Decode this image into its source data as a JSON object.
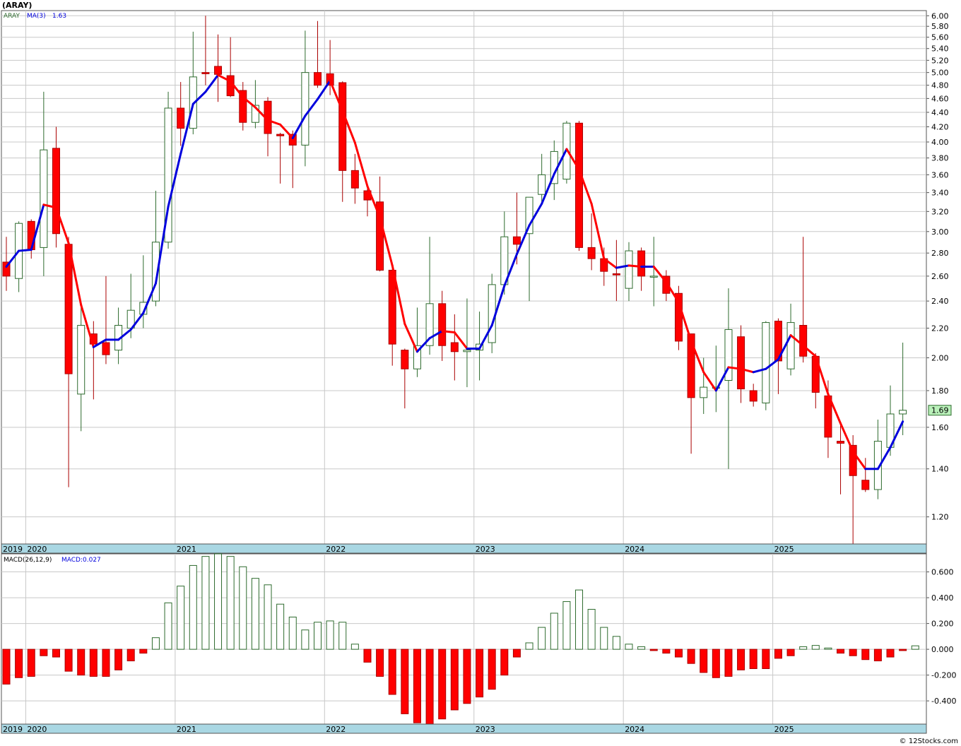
{
  "title": "(ARAY)",
  "watermark": "© 12Stocks.com",
  "colors": {
    "up_body": "#ffffff",
    "up_outline": "#2e6b2e",
    "down_body": "#ff0000",
    "down_outline": "#aa0000",
    "ma_up": "#0000dd",
    "ma_down": "#ff0000",
    "grid": "#c8c8c8",
    "axis_band": "#a9d7e3",
    "last_price_bg": "#b9f0b9"
  },
  "chart_data": [
    {
      "type": "candlestick",
      "legend": {
        "symbol": "ARAY",
        "ma_label": "MA(3)",
        "ma_value": "1.63"
      },
      "last_price_label": "1.69",
      "yscale": "log",
      "ylim": [
        1.1,
        6.1
      ],
      "y_ticks": [
        "6.00",
        "5.80",
        "5.60",
        "5.40",
        "5.20",
        "5.00",
        "4.80",
        "4.60",
        "4.40",
        "4.20",
        "4.00",
        "3.80",
        "3.60",
        "3.40",
        "3.20",
        "3.00",
        "2.80",
        "2.60",
        "2.40",
        "2.20",
        "2.00",
        "1.80",
        "1.60",
        "1.40",
        "1.20"
      ],
      "x_labels": [
        "2019",
        "2020",
        "2021",
        "2022",
        "2023",
        "2024",
        "2025"
      ],
      "candles": [
        [
          "2019-11",
          2.72,
          2.95,
          2.48,
          2.6
        ],
        [
          "2019-12",
          2.58,
          3.1,
          2.47,
          3.08
        ],
        [
          "2020-01",
          3.1,
          3.12,
          2.75,
          2.83
        ],
        [
          "2020-02",
          2.85,
          4.7,
          2.6,
          3.9
        ],
        [
          "2020-03",
          3.92,
          4.2,
          2.85,
          2.98
        ],
        [
          "2020-04",
          2.88,
          2.95,
          1.32,
          1.9
        ],
        [
          "2020-05",
          1.78,
          2.35,
          1.58,
          2.22
        ],
        [
          "2020-06",
          2.16,
          2.25,
          1.75,
          2.09
        ],
        [
          "2020-07",
          2.1,
          2.6,
          1.96,
          2.02
        ],
        [
          "2020-08",
          2.05,
          2.35,
          1.96,
          2.22
        ],
        [
          "2020-09",
          2.2,
          2.62,
          2.13,
          2.33
        ],
        [
          "2020-10",
          2.3,
          2.78,
          2.2,
          2.39
        ],
        [
          "2020-11",
          2.4,
          3.42,
          2.36,
          2.9
        ],
        [
          "2020-12",
          2.9,
          4.7,
          2.84,
          4.46
        ],
        [
          "2021-01",
          4.46,
          4.85,
          3.95,
          4.18
        ],
        [
          "2021-02",
          4.18,
          5.7,
          4.1,
          4.93
        ],
        [
          "2021-03",
          5.0,
          6.0,
          4.8,
          4.98
        ],
        [
          "2021-04",
          5.1,
          5.65,
          4.55,
          4.97
        ],
        [
          "2021-05",
          4.95,
          5.6,
          4.62,
          4.64
        ],
        [
          "2021-06",
          4.72,
          4.85,
          4.15,
          4.26
        ],
        [
          "2021-07",
          4.26,
          4.88,
          4.18,
          4.5
        ],
        [
          "2021-08",
          4.56,
          4.62,
          3.82,
          4.11
        ],
        [
          "2021-09",
          4.1,
          4.12,
          3.5,
          4.08
        ],
        [
          "2021-10",
          4.1,
          4.15,
          3.45,
          3.96
        ],
        [
          "2021-11",
          3.96,
          5.72,
          3.7,
          5.0
        ],
        [
          "2021-12",
          5.0,
          5.9,
          4.76,
          4.8
        ],
        [
          "2022-01",
          4.98,
          5.55,
          4.65,
          4.8
        ],
        [
          "2022-02",
          4.84,
          4.86,
          3.3,
          3.65
        ],
        [
          "2022-03",
          3.65,
          3.85,
          3.28,
          3.45
        ],
        [
          "2022-04",
          3.42,
          3.48,
          3.15,
          3.32
        ],
        [
          "2022-05",
          3.3,
          3.58,
          2.64,
          2.65
        ],
        [
          "2022-06",
          2.65,
          2.66,
          1.95,
          2.09
        ],
        [
          "2022-07",
          2.05,
          2.06,
          1.7,
          1.93
        ],
        [
          "2022-08",
          1.93,
          2.35,
          1.88,
          2.08
        ],
        [
          "2022-09",
          2.08,
          2.95,
          2.02,
          2.38
        ],
        [
          "2022-10",
          2.38,
          2.48,
          1.98,
          2.08
        ],
        [
          "2022-11",
          2.1,
          2.3,
          1.86,
          2.04
        ],
        [
          "2022-12",
          2.04,
          2.42,
          1.82,
          2.05
        ],
        [
          "2023-01",
          2.05,
          2.32,
          1.86,
          2.09
        ],
        [
          "2023-02",
          2.1,
          2.62,
          2.03,
          2.53
        ],
        [
          "2023-03",
          2.53,
          3.2,
          2.45,
          2.95
        ],
        [
          "2023-04",
          2.95,
          3.4,
          2.7,
          2.88
        ],
        [
          "2023-05",
          2.98,
          3.35,
          2.4,
          3.35
        ],
        [
          "2023-06",
          3.38,
          3.85,
          3.3,
          3.6
        ],
        [
          "2023-07",
          3.5,
          4.02,
          3.32,
          3.88
        ],
        [
          "2023-08",
          3.55,
          4.28,
          3.5,
          4.25
        ],
        [
          "2023-09",
          4.25,
          4.28,
          2.82,
          2.85
        ],
        [
          "2023-10",
          2.85,
          3.18,
          2.65,
          2.75
        ],
        [
          "2023-11",
          2.75,
          2.85,
          2.52,
          2.64
        ],
        [
          "2023-12",
          2.62,
          2.92,
          2.4,
          2.61
        ],
        [
          "2024-01",
          2.5,
          2.9,
          2.4,
          2.82
        ],
        [
          "2024-02",
          2.82,
          2.85,
          2.48,
          2.6
        ],
        [
          "2024-03",
          2.6,
          2.95,
          2.36,
          2.6
        ],
        [
          "2024-04",
          2.6,
          2.65,
          2.4,
          2.46
        ],
        [
          "2024-05",
          2.46,
          2.52,
          2.05,
          2.11
        ],
        [
          "2024-06",
          2.16,
          2.16,
          1.47,
          1.76
        ],
        [
          "2024-07",
          1.76,
          2.0,
          1.67,
          1.82
        ],
        [
          "2024-08",
          1.82,
          2.08,
          1.68,
          1.82
        ],
        [
          "2024-09",
          1.86,
          2.5,
          1.4,
          2.19
        ],
        [
          "2024-10",
          2.14,
          2.22,
          1.73,
          1.81
        ],
        [
          "2024-11",
          1.8,
          1.84,
          1.71,
          1.74
        ],
        [
          "2024-12",
          1.73,
          2.25,
          1.69,
          2.24
        ],
        [
          "2025-01",
          2.25,
          2.27,
          1.78,
          1.98
        ],
        [
          "2025-02",
          1.93,
          2.38,
          1.89,
          2.24
        ],
        [
          "2025-03",
          2.22,
          2.95,
          1.97,
          2.01
        ],
        [
          "2025-04",
          2.01,
          2.03,
          1.7,
          1.79
        ],
        [
          "2025-05",
          1.77,
          1.86,
          1.45,
          1.55
        ],
        [
          "2025-06",
          1.53,
          1.61,
          1.29,
          1.52
        ],
        [
          "2025-07",
          1.51,
          1.56,
          1.1,
          1.37
        ],
        [
          "2025-08",
          1.35,
          1.45,
          1.3,
          1.31
        ],
        [
          "2025-09",
          1.31,
          1.64,
          1.27,
          1.53
        ],
        [
          "2025-10",
          1.5,
          1.83,
          1.46,
          1.67
        ],
        [
          "2025-11",
          1.67,
          2.1,
          1.56,
          1.69
        ]
      ],
      "ma": [
        2.68,
        2.82,
        2.83,
        3.27,
        3.24,
        2.89,
        2.37,
        2.07,
        2.12,
        2.12,
        2.19,
        2.31,
        2.54,
        3.25,
        3.85,
        4.52,
        4.7,
        4.96,
        4.86,
        4.62,
        4.47,
        4.29,
        4.23,
        4.05,
        4.35,
        4.59,
        4.87,
        4.42,
        3.99,
        3.47,
        3.14,
        2.69,
        2.23,
        2.04,
        2.13,
        2.18,
        2.17,
        2.06,
        2.06,
        2.22,
        2.52,
        2.79,
        3.06,
        3.28,
        3.61,
        3.91,
        3.66,
        3.28,
        2.75,
        2.67,
        2.69,
        2.68,
        2.68,
        2.55,
        2.39,
        2.11,
        1.91,
        1.8,
        1.94,
        1.93,
        1.91,
        1.93,
        1.99,
        2.15,
        2.08,
        2.01,
        1.78,
        1.62,
        1.48,
        1.4,
        1.4,
        1.5,
        1.63
      ]
    },
    {
      "type": "bar",
      "legend": {
        "label": "MACD(26,12,9)",
        "value_label": "MACD:0.027"
      },
      "ylim": [
        -0.58,
        0.74
      ],
      "y_ticks": [
        "0.600",
        "0.400",
        "0.200",
        "0.000",
        "-0.200",
        "-0.400"
      ],
      "x_labels": [
        "2019",
        "2020",
        "2021",
        "2022",
        "2023",
        "2024",
        "2025"
      ],
      "values": [
        -0.27,
        -0.22,
        -0.21,
        -0.05,
        -0.06,
        -0.17,
        -0.2,
        -0.21,
        -0.21,
        -0.16,
        -0.09,
        -0.03,
        0.09,
        0.36,
        0.49,
        0.65,
        0.72,
        0.74,
        0.72,
        0.64,
        0.55,
        0.5,
        0.35,
        0.25,
        0.15,
        0.21,
        0.22,
        0.21,
        0.04,
        -0.1,
        -0.21,
        -0.35,
        -0.5,
        -0.57,
        -0.59,
        -0.54,
        -0.47,
        -0.42,
        -0.37,
        -0.31,
        -0.2,
        -0.06,
        0.05,
        0.17,
        0.28,
        0.37,
        0.46,
        0.31,
        0.17,
        0.1,
        0.04,
        0.02,
        -0.01,
        -0.03,
        -0.06,
        -0.11,
        -0.18,
        -0.22,
        -0.21,
        -0.16,
        -0.15,
        -0.15,
        -0.07,
        -0.05,
        0.02,
        0.03,
        0.01,
        -0.03,
        -0.05,
        -0.08,
        -0.09,
        -0.06,
        -0.01,
        0.027
      ]
    }
  ]
}
